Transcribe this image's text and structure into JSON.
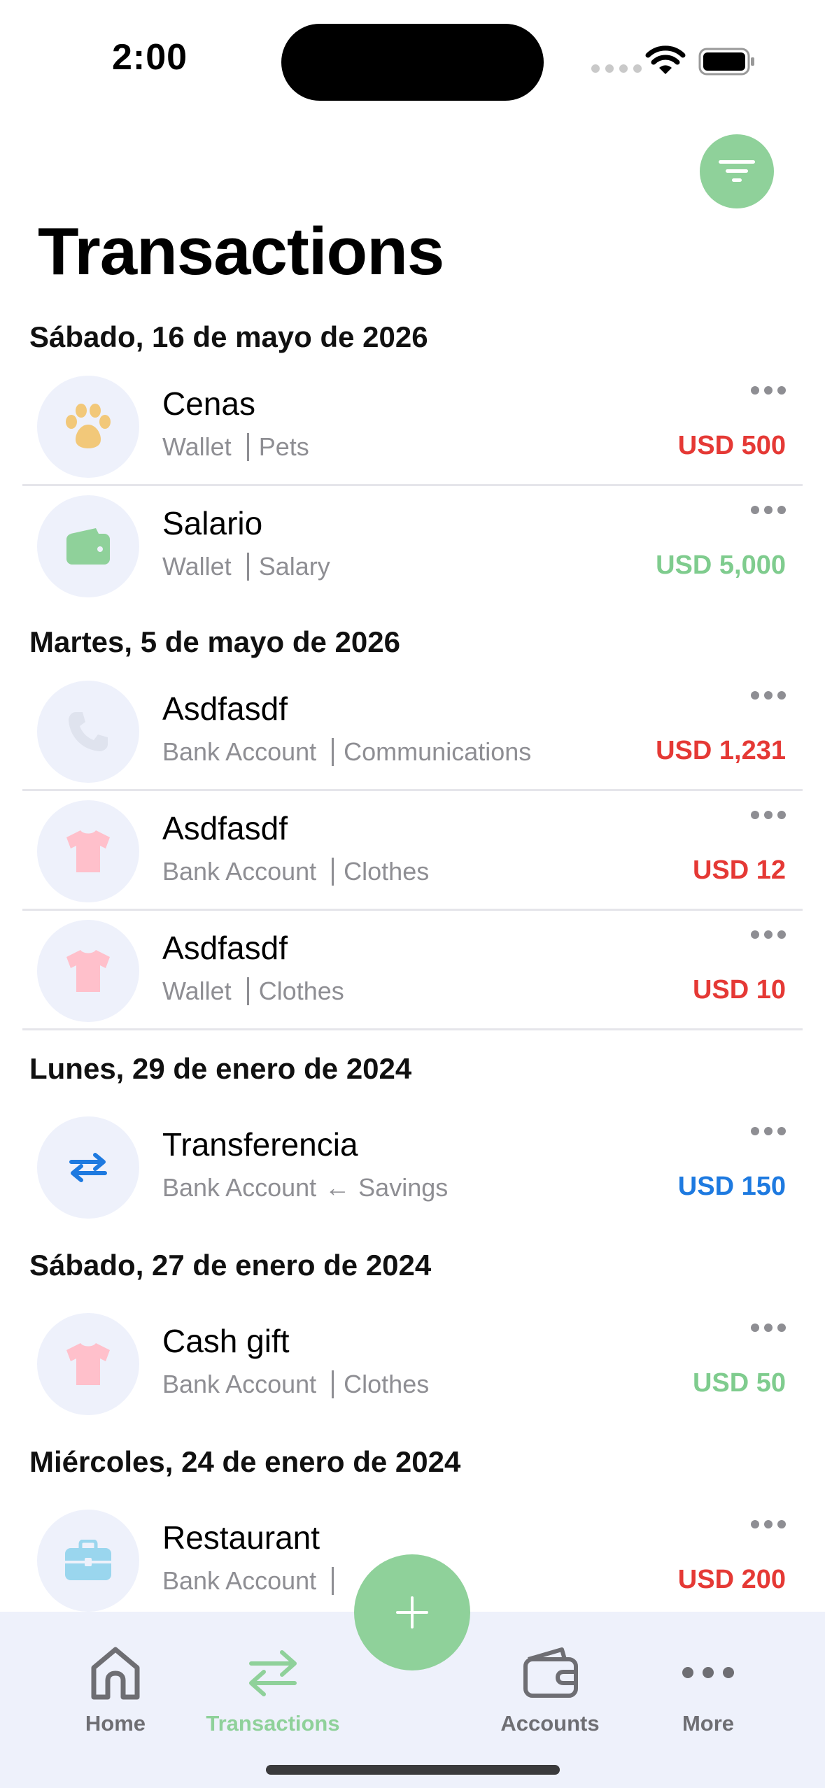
{
  "status_bar": {
    "time": "2:00"
  },
  "page": {
    "title": "Transactions"
  },
  "sections": [
    {
      "date": "Sábado, 16 de mayo de 2026",
      "items": [
        {
          "title": "Cenas",
          "account": "Wallet",
          "category": "Pets",
          "amount": "USD 500",
          "kind": "expense",
          "icon": "paw-icon",
          "icon_color": "#f2c879"
        },
        {
          "title": "Salario",
          "account": "Wallet",
          "category": "Salary",
          "amount": "USD 5,000",
          "kind": "income",
          "icon": "wallet-icon",
          "icon_color": "#8fd19a"
        }
      ]
    },
    {
      "date": "Martes, 5 de mayo de 2026",
      "items": [
        {
          "title": "Asdfasdf",
          "account": "Bank Account",
          "category": "Communications",
          "amount": "USD 1,231",
          "kind": "expense",
          "icon": "phone-icon",
          "icon_color": "#dfe3ee"
        },
        {
          "title": "Asdfasdf",
          "account": "Bank Account",
          "category": "Clothes",
          "amount": "USD 12",
          "kind": "expense",
          "icon": "tshirt-icon",
          "icon_color": "#ffc0cb"
        },
        {
          "title": "Asdfasdf",
          "account": "Wallet",
          "category": "Clothes",
          "amount": "USD 10",
          "kind": "expense",
          "icon": "tshirt-icon",
          "icon_color": "#ffc0cb"
        }
      ]
    },
    {
      "date": "Lunes, 29 de enero de 2024",
      "items": [
        {
          "title": "Transferencia",
          "account": "Bank Account",
          "arrow": "←",
          "category": "Savings",
          "amount": "USD 150",
          "kind": "transfer",
          "icon": "transfer-icon",
          "icon_color": "#1e7ae0"
        }
      ]
    },
    {
      "date": "Sábado, 27 de enero de 2024",
      "items": [
        {
          "title": "Cash gift",
          "account": "Bank Account",
          "category": "Clothes",
          "amount": "USD 50",
          "kind": "income",
          "icon": "tshirt-icon",
          "icon_color": "#ffc0cb"
        }
      ]
    },
    {
      "date": "Miércoles, 24 de enero de 2024",
      "items": [
        {
          "title": "Restaurant",
          "account": "Bank Account",
          "category": "",
          "amount": "USD 200",
          "kind": "expense",
          "icon": "briefcase-icon",
          "icon_color": "#9ad6ee"
        }
      ]
    }
  ],
  "tab_bar": {
    "items": [
      {
        "label": "Home",
        "icon": "home-icon",
        "active": false
      },
      {
        "label": "Transactions",
        "icon": "transfer-arrows-icon",
        "active": true
      },
      {
        "label": "Accounts",
        "icon": "wallet-icon",
        "active": false
      },
      {
        "label": "More",
        "icon": "more-icon",
        "active": false
      }
    ]
  },
  "colors": {
    "accent": "#8fd19a",
    "expense": "#e53935",
    "income": "#7fcc8e",
    "transfer": "#1e7ae0"
  }
}
